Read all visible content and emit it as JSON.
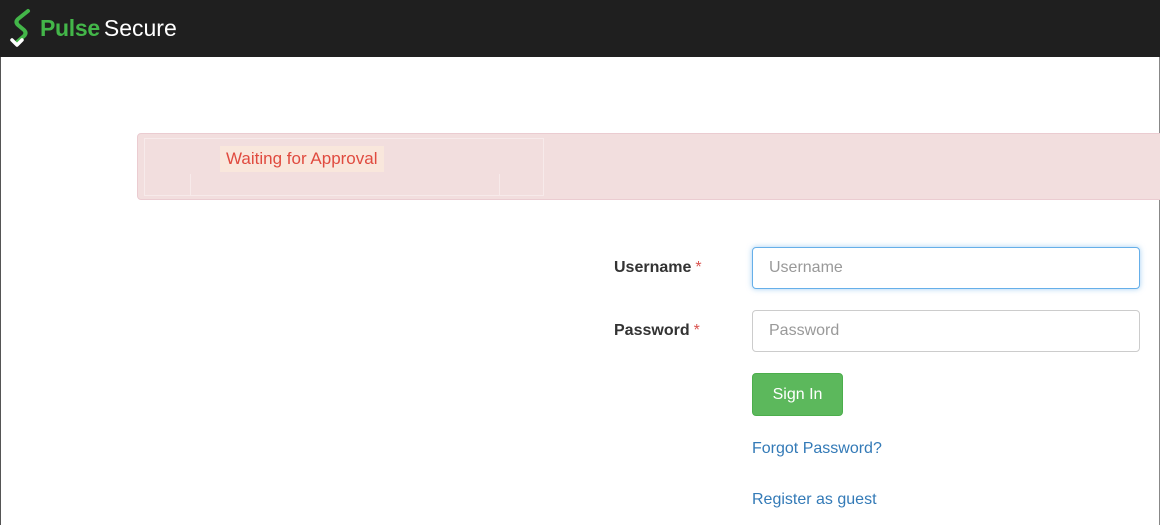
{
  "header": {
    "brand_primary": "Pulse",
    "brand_secondary": "Secure",
    "logo_icon": "pulse-secure-logo-icon",
    "background_color": "#1f1f1f",
    "brand_color": "#43b649"
  },
  "alert": {
    "message": "Waiting for Approval",
    "background_color": "#f2dede",
    "text_color": "#e04b3f"
  },
  "form": {
    "username_label": "Username",
    "password_label": "Password",
    "required_marker": "*",
    "username_placeholder": "Username",
    "username_value": "",
    "password_placeholder": "Password",
    "password_value": "",
    "signin_label": "Sign In",
    "signin_color": "#5cb85c"
  },
  "links": {
    "forgot_password": "Forgot Password?",
    "register_guest": "Register as guest",
    "link_color": "#337ab7"
  }
}
